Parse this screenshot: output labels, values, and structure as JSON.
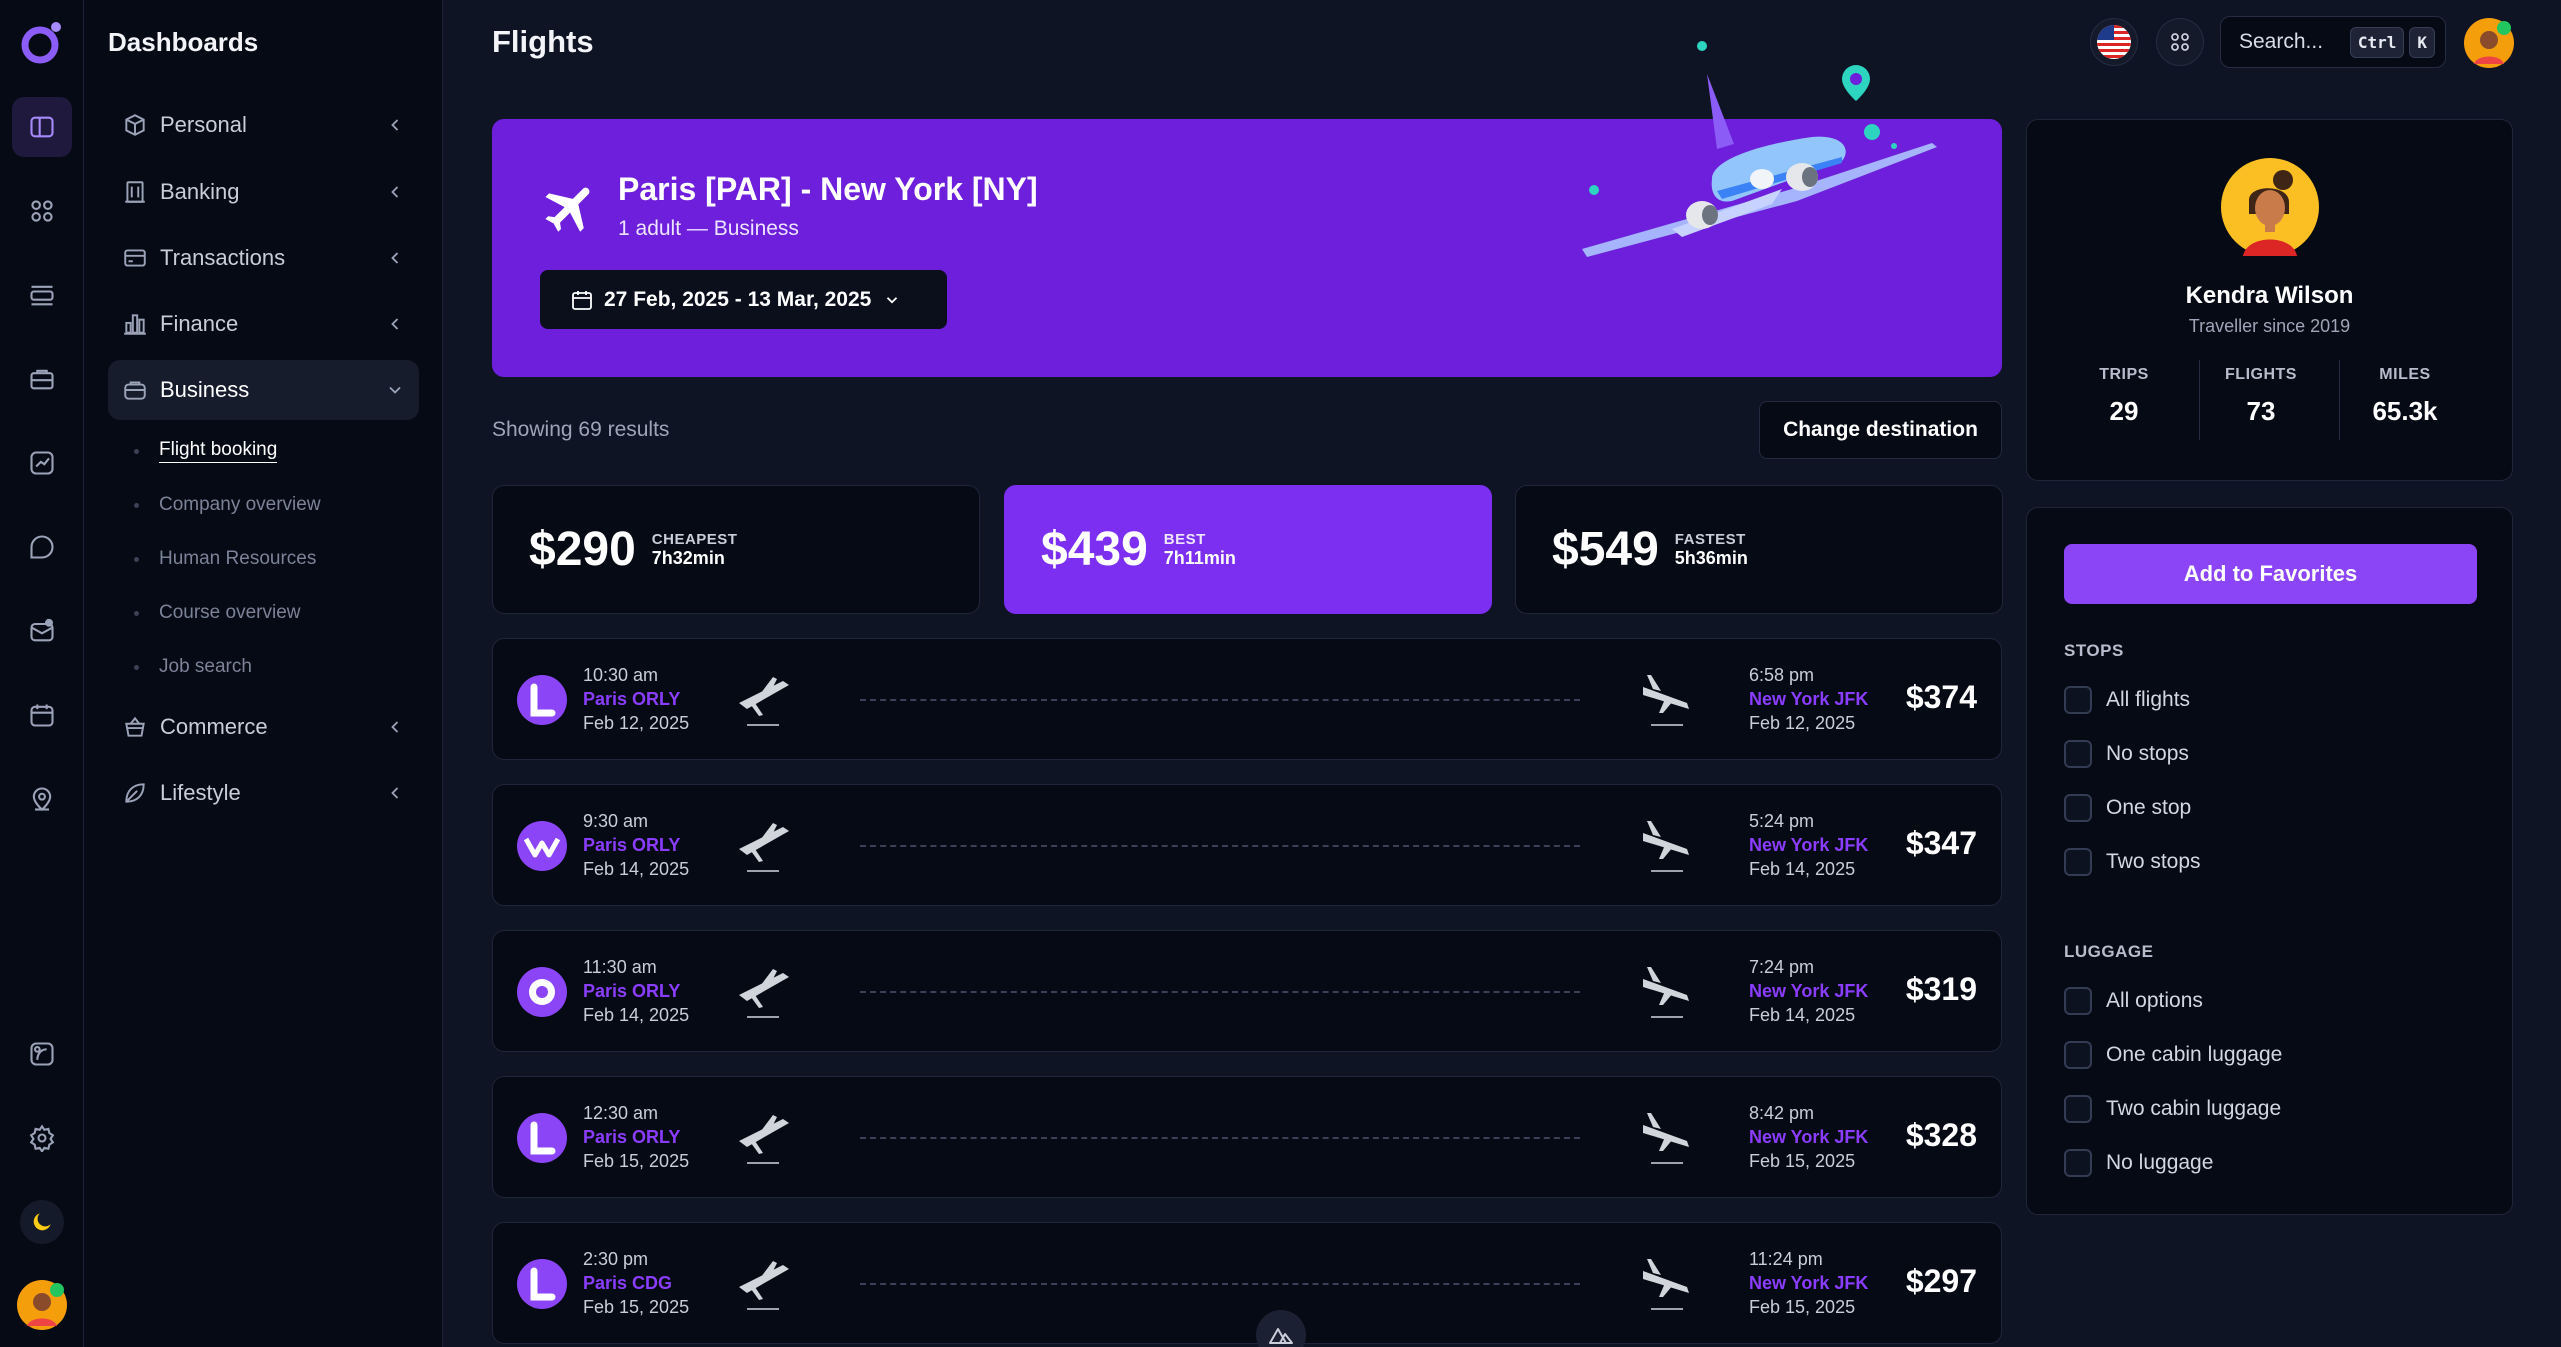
{
  "app": {
    "section_title": "Dashboards",
    "page_title": "Flights"
  },
  "rail_icons": [
    "dashboard-icon",
    "grid-icon",
    "list-icon",
    "briefcase-icon",
    "chart-icon",
    "chat-icon",
    "mail-icon",
    "calendar-icon",
    "map-pin-icon",
    "design-icon",
    "settings-icon",
    "moon-icon"
  ],
  "sidebar": {
    "items": [
      {
        "label": "Personal",
        "icon": "box-icon"
      },
      {
        "label": "Banking",
        "icon": "bank-icon"
      },
      {
        "label": "Transactions",
        "icon": "card-icon"
      },
      {
        "label": "Finance",
        "icon": "finance-icon"
      },
      {
        "label": "Business",
        "icon": "business-icon"
      },
      {
        "label": "Commerce",
        "icon": "basket-icon"
      },
      {
        "label": "Lifestyle",
        "icon": "leaf-icon"
      }
    ],
    "business_sub": [
      "Flight booking",
      "Company overview",
      "Human Resources",
      "Course overview",
      "Job search"
    ]
  },
  "topbar": {
    "search_placeholder": "Search...",
    "kbd_ctrl": "Ctrl",
    "kbd_k": "K"
  },
  "hero": {
    "route": "Paris [PAR] - New York [NY]",
    "passengers": "1 adult — Business",
    "dates": "27 Feb, 2025 - 13 Mar, 2025"
  },
  "results": {
    "count_text": "Showing 69 results",
    "change_label": "Change destination"
  },
  "price_cards": [
    {
      "price": "$290",
      "tag": "Cheapest",
      "time": "7h32min"
    },
    {
      "price": "$439",
      "tag": "Best",
      "time": "7h11min"
    },
    {
      "price": "$549",
      "tag": "Fastest",
      "time": "5h36min"
    }
  ],
  "flights": [
    {
      "dep_time": "10:30 am",
      "dep_port": "Paris ORLY",
      "dep_date": "Feb 12, 2025",
      "arr_time": "6:58 pm",
      "arr_port": "New York JFK",
      "arr_date": "Feb 12, 2025",
      "price": "$374",
      "logo": "airline-logo-l"
    },
    {
      "dep_time": "9:30 am",
      "dep_port": "Paris ORLY",
      "dep_date": "Feb 14, 2025",
      "arr_time": "5:24 pm",
      "arr_port": "New York JFK",
      "arr_date": "Feb 14, 2025",
      "price": "$347",
      "logo": "airline-logo-wave"
    },
    {
      "dep_time": "11:30 am",
      "dep_port": "Paris ORLY",
      "dep_date": "Feb 14, 2025",
      "arr_time": "7:24 pm",
      "arr_port": "New York JFK",
      "arr_date": "Feb 14, 2025",
      "price": "$319",
      "logo": "airline-logo-ring"
    },
    {
      "dep_time": "12:30 am",
      "dep_port": "Paris ORLY",
      "dep_date": "Feb 15, 2025",
      "arr_time": "8:42 pm",
      "arr_port": "New York JFK",
      "arr_date": "Feb 15, 2025",
      "price": "$328",
      "logo": "airline-logo-l"
    },
    {
      "dep_time": "2:30 pm",
      "dep_port": "Paris CDG",
      "dep_date": "Feb 15, 2025",
      "arr_time": "11:24 pm",
      "arr_port": "New York JFK",
      "arr_date": "Feb 15, 2025",
      "price": "$297",
      "logo": "airline-logo-l"
    }
  ],
  "profile": {
    "name": "Kendra Wilson",
    "subtitle": "Traveller since 2019",
    "stats": [
      {
        "label": "TRIPS",
        "value": "29"
      },
      {
        "label": "FLIGHTS",
        "value": "73"
      },
      {
        "label": "MILES",
        "value": "65.3k"
      }
    ]
  },
  "filters": {
    "favorites_label": "Add to Favorites",
    "stops_title": "STOPS",
    "stops": [
      "All flights",
      "No stops",
      "One stop",
      "Two stops"
    ],
    "luggage_title": "LUGGAGE",
    "luggage": [
      "All options",
      "One cabin luggage",
      "Two cabin luggage",
      "No luggage"
    ]
  },
  "colors": {
    "accent": "#7c2ff0",
    "hero_bg": "#6d1fdc",
    "airport_text": "#8b3dff",
    "background": "#0f1424",
    "panel": "#060a14"
  }
}
